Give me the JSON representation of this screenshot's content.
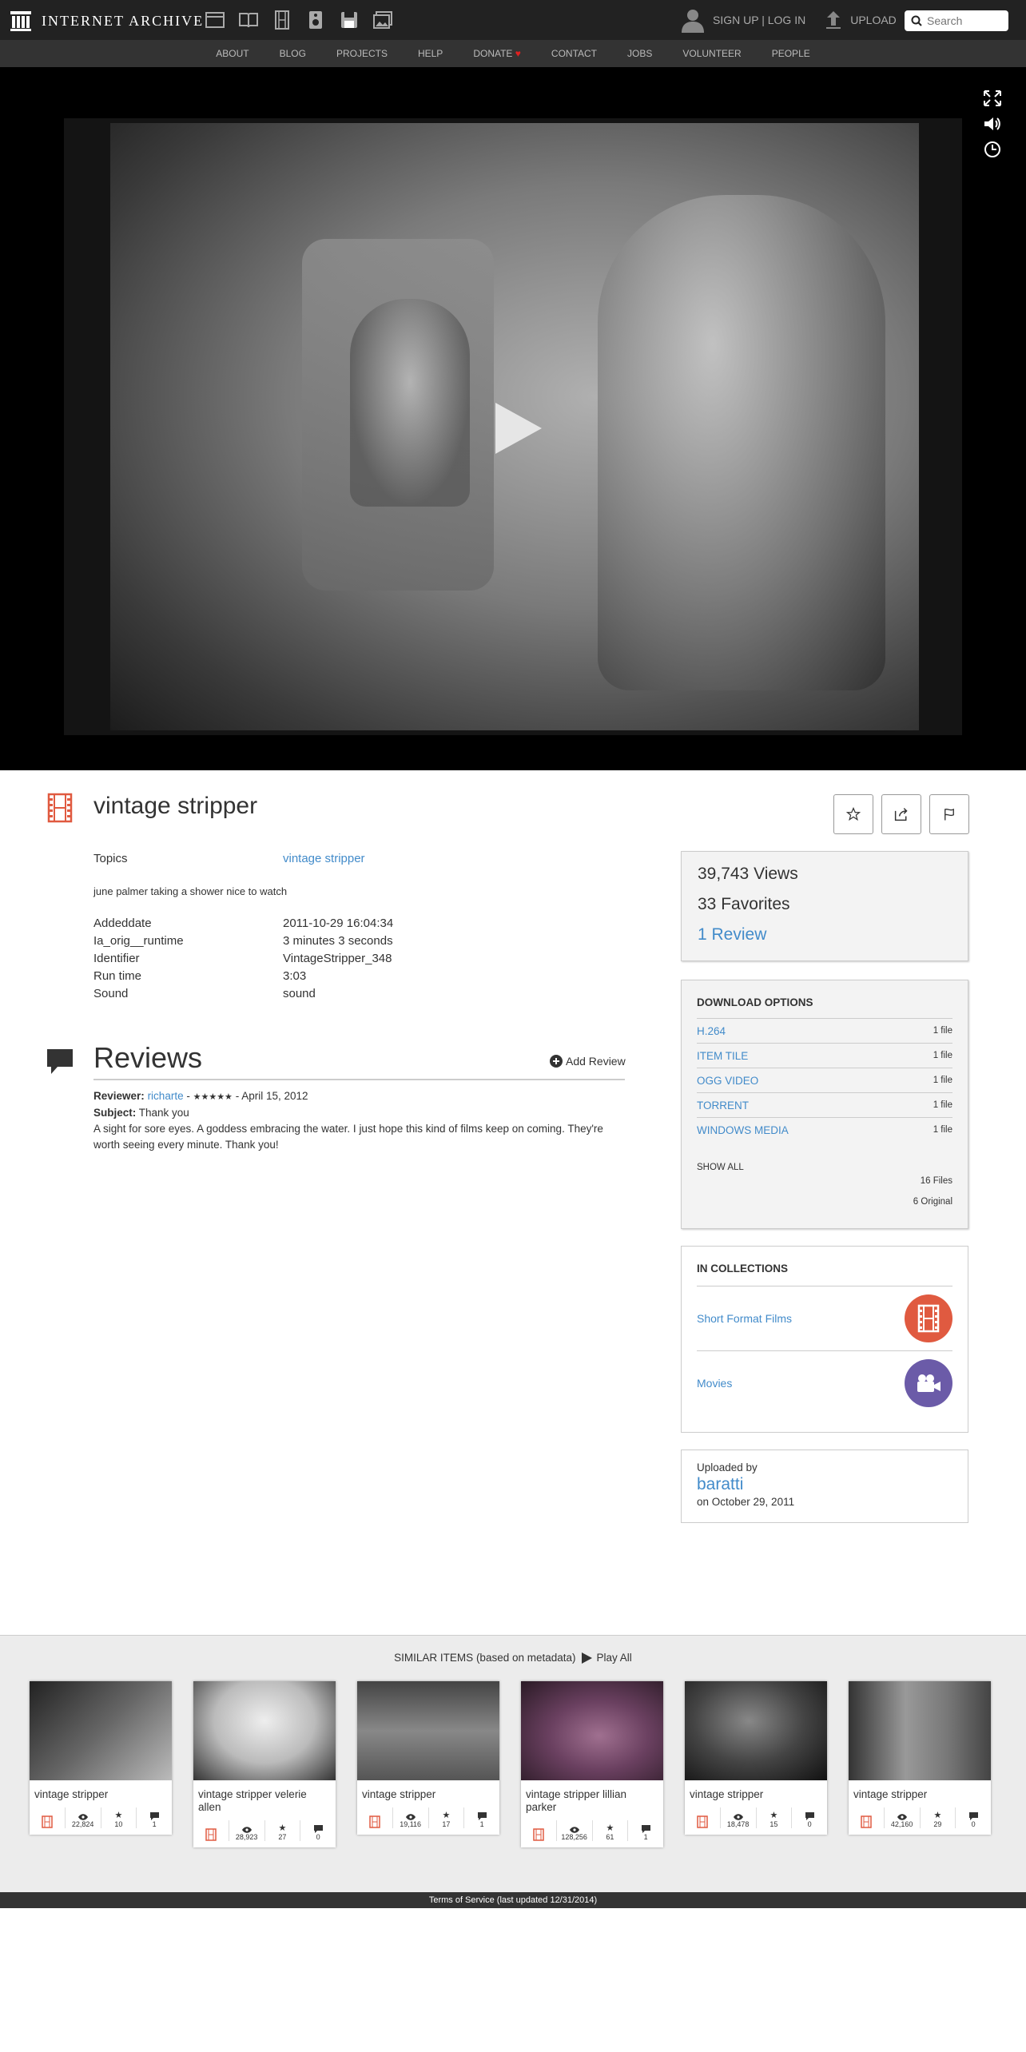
{
  "header": {
    "logo_text": "INTERNET ARCHIVE",
    "media_icons": [
      "web-icon",
      "texts-icon",
      "video-icon",
      "audio-icon",
      "software-icon",
      "images-icon"
    ],
    "signup_label": "SIGN UP",
    "separator": "|",
    "login_label": "LOG IN",
    "upload_label": "UPLOAD",
    "search_placeholder": "Search"
  },
  "subnav": [
    "ABOUT",
    "BLOG",
    "PROJECTS",
    "HELP",
    "DONATE",
    "CONTACT",
    "JOBS",
    "VOLUNTEER",
    "PEOPLE"
  ],
  "colors": {
    "accent": "#428bca",
    "film_red": "#e05a40",
    "donate_heart": "#e02020",
    "movies_purple": "#6b5ba8"
  },
  "item": {
    "title": "vintage stripper",
    "topics_label": "Topics",
    "topics_value": "vintage stripper",
    "description": "june palmer taking a shower nice to watch",
    "metadata": [
      {
        "k": "Addeddate",
        "v": "2011-10-29 16:04:34"
      },
      {
        "k": "Ia_orig__runtime",
        "v": "3 minutes 3 seconds"
      },
      {
        "k": "Identifier",
        "v": "VintageStripper_348"
      },
      {
        "k": "Run time",
        "v": "3:03"
      },
      {
        "k": "Sound",
        "v": "sound"
      }
    ]
  },
  "reviews": {
    "heading": "Reviews",
    "add_label": "Add Review",
    "reviewer_label": "Reviewer:",
    "reviewer": "richarte",
    "dash": "-",
    "stars": "★★★★★",
    "date": "- April 15, 2012",
    "subject_label": "Subject:",
    "subject": "Thank you",
    "body": "A sight for sore eyes. A goddess embracing the water. I just hope this kind of films keep on coming. They're worth seeing every minute. Thank you!"
  },
  "stats": {
    "views": "39,743 Views",
    "favorites": "33 Favorites",
    "reviews": "1 Review"
  },
  "downloads": {
    "heading": "DOWNLOAD OPTIONS",
    "rows": [
      {
        "label": "H.264",
        "count": "1 file"
      },
      {
        "label": "ITEM TILE",
        "count": "1 file"
      },
      {
        "label": "OGG VIDEO",
        "count": "1 file"
      },
      {
        "label": "TORRENT",
        "count": "1 file"
      },
      {
        "label": "WINDOWS MEDIA",
        "count": "1 file"
      }
    ],
    "show_all": "SHOW ALL",
    "files": "16 Files",
    "original": "6 Original"
  },
  "collections": {
    "heading": "IN COLLECTIONS",
    "items": [
      {
        "label": "Short Format Films"
      },
      {
        "label": "Movies"
      }
    ]
  },
  "uploader": {
    "label": "Uploaded by",
    "name": "baratti",
    "date": "on October 29, 2011"
  },
  "similar": {
    "heading": "SIMILAR ITEMS (based on metadata)",
    "play_all": "Play All",
    "items": [
      {
        "title": "vintage stripper",
        "views": "22,824",
        "favs": "10",
        "reviews": "1"
      },
      {
        "title": "vintage stripper velerie allen",
        "views": "28,923",
        "favs": "27",
        "reviews": "0"
      },
      {
        "title": "vintage stripper",
        "views": "19,116",
        "favs": "17",
        "reviews": "1"
      },
      {
        "title": "vintage stripper lillian parker",
        "views": "128,256",
        "favs": "61",
        "reviews": "1"
      },
      {
        "title": "vintage stripper",
        "views": "18,478",
        "favs": "15",
        "reviews": "0"
      },
      {
        "title": "vintage stripper",
        "views": "42,160",
        "favs": "29",
        "reviews": "0"
      }
    ]
  },
  "footer": "Terms of Service (last updated 12/31/2014)"
}
